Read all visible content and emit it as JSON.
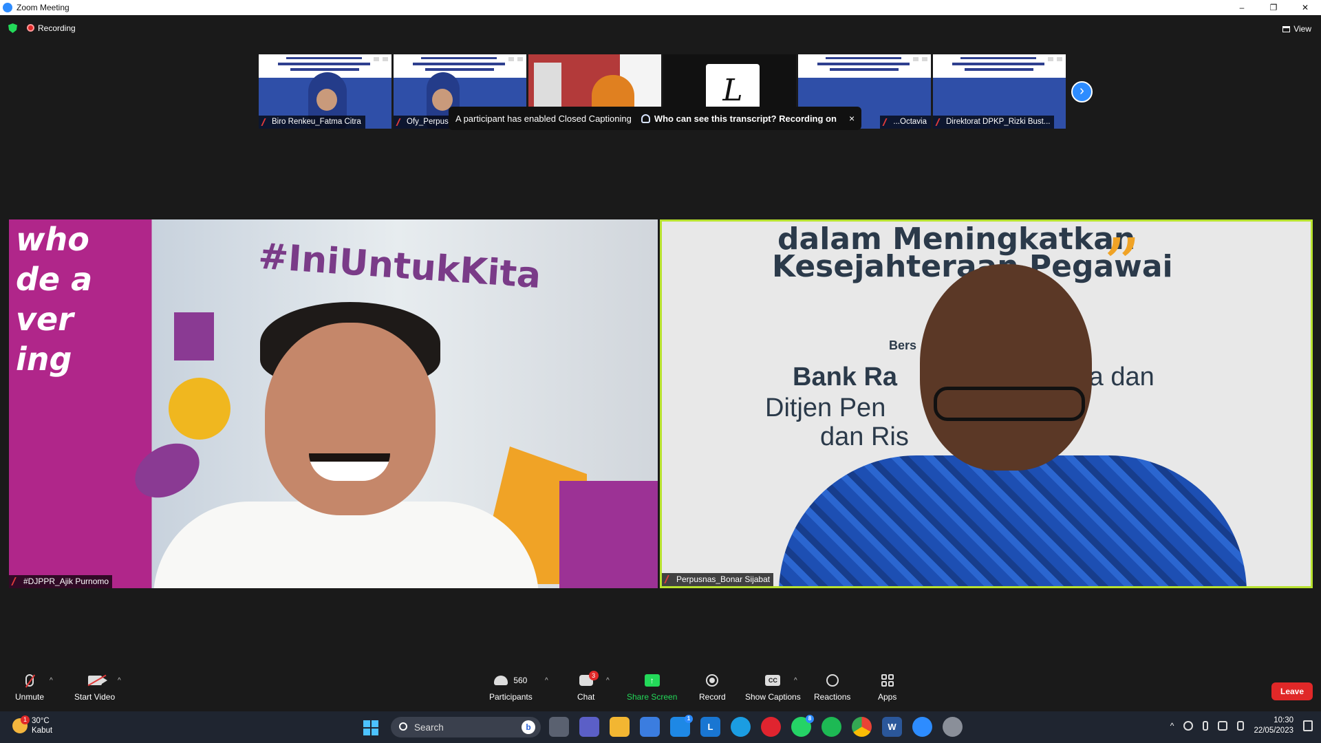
{
  "window": {
    "title": "Zoom Meeting",
    "controls": [
      "–",
      "❐",
      "✕"
    ]
  },
  "meeting": {
    "recording_label": "Recording",
    "view_label": "View",
    "thumbnails": [
      {
        "name": "Biro Renkeu_Fatma Citra",
        "muted": true
      },
      {
        "name": "Ofy_Perpusna...",
        "muted": true
      },
      {
        "name": "",
        "muted": false
      },
      {
        "name": "",
        "muted": false
      },
      {
        "name": "...Octavia",
        "muted": true
      },
      {
        "name": "Direktorat DPKP_Rizki Bust...",
        "muted": true
      }
    ],
    "cc_banner": {
      "text": "A participant has enabled Closed Captioning",
      "link": "Who can see this transcript? Recording on",
      "close": "×"
    },
    "video_left": {
      "name": "#DJPPR_Ajik Purnomo",
      "bg_hashtag": "#IniUntukKita",
      "bg_left_text": [
        "who",
        "de a",
        "ver",
        "ing"
      ]
    },
    "video_right": {
      "name": "Perpusnas_Bonar Sijabat",
      "bg_line_a": "dalam  Meningkatkan",
      "bg_line_b": "Kesejahteraan  Pegawai",
      "bg_bers": "Bers",
      "bg_line1_bold": "Bank Ra",
      "bg_line1_rest": "esia dan",
      "bg_line2": "Ditjen Pen            mbiayaan",
      "bg_line3": "dan Ris           enkeu",
      "quote_mark": "”",
      "active_speaker_color": "#b8e22f"
    }
  },
  "toolbar": {
    "unmute": "Unmute",
    "start_video": "Start Video",
    "participants": "Participants",
    "participants_count": "560",
    "chat": "Chat",
    "chat_badge": "3",
    "share_screen": "Share Screen",
    "record": "Record",
    "show_captions": "Show Captions",
    "cc_icon": "CC",
    "reactions": "Reactions",
    "apps": "Apps",
    "leave": "Leave",
    "accent_green": "#23d959",
    "leave_color": "#e02828"
  },
  "taskbar": {
    "weather_temp": "30°C",
    "weather_desc": "Kabut",
    "weather_badge": "1",
    "search_placeholder": "Search",
    "whatsapp_badge": "8",
    "mail_badge": "1",
    "time": "10:30",
    "date": "22/05/2023"
  }
}
